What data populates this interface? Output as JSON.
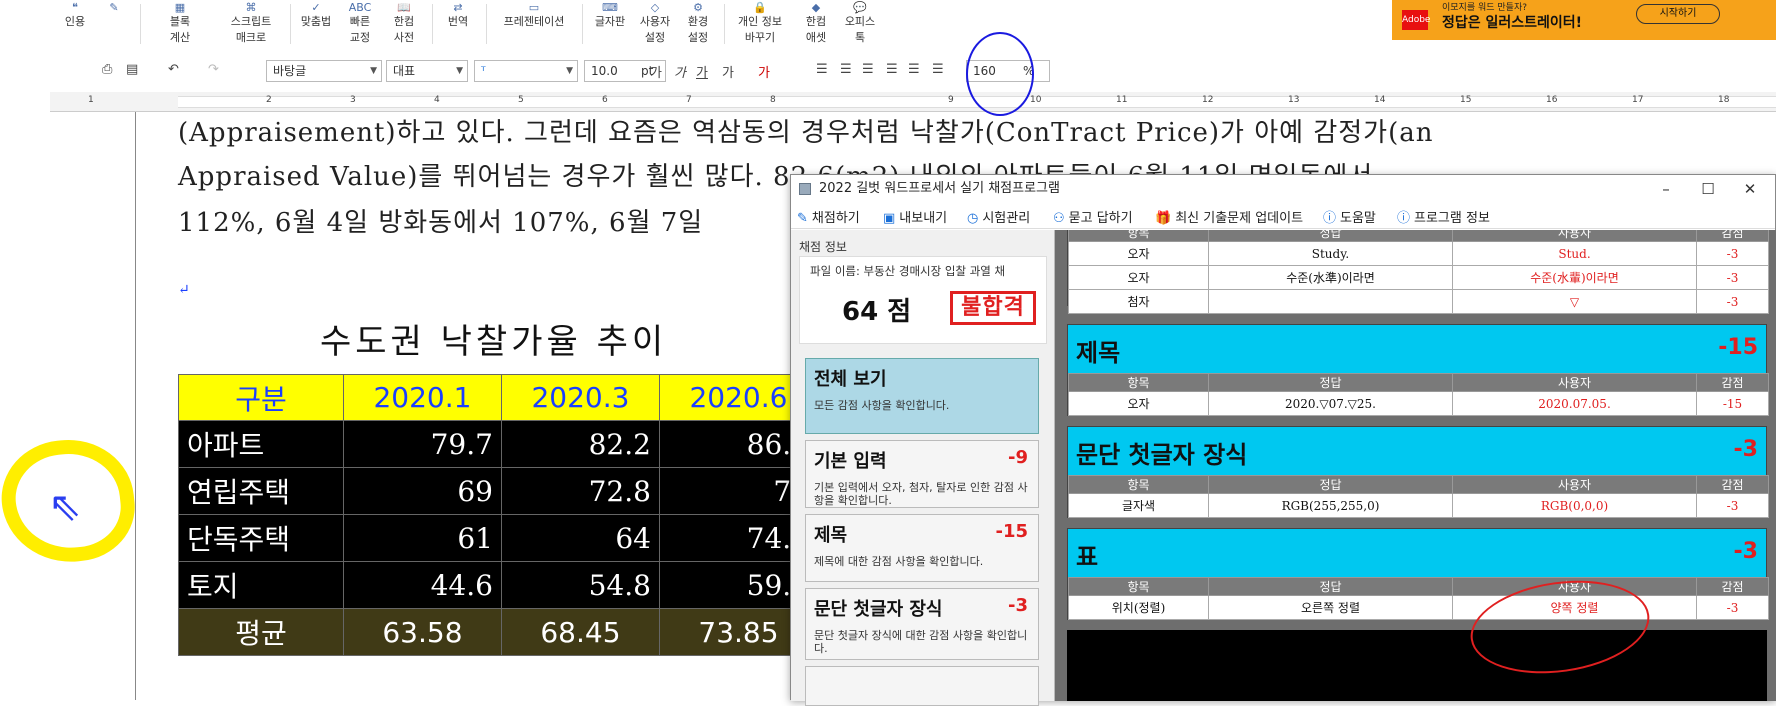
{
  "ribbon": {
    "items": [
      {
        "label": "인용",
        "icon": "quote-icon"
      },
      {
        "label": "블록\n계산",
        "icon": "block-calc-icon"
      },
      {
        "label": "스크립트\n매크로",
        "icon": "script-icon"
      },
      {
        "label": "맞춤법",
        "icon": "spellcheck-icon"
      },
      {
        "label": "빠른\n교정",
        "icon": "abc-icon"
      },
      {
        "label": "한컴\n사전",
        "icon": "dictionary-icon"
      },
      {
        "label": "번역",
        "icon": "translate-icon"
      },
      {
        "label": "프레젠테이션",
        "icon": "presentation-icon"
      },
      {
        "label": "글자판",
        "icon": "keyboard-icon"
      },
      {
        "label": "사용자\n설정",
        "icon": "user-settings-icon"
      },
      {
        "label": "환경\n설정",
        "icon": "settings-icon"
      },
      {
        "label": "개인 정보\n바꾸기",
        "icon": "privacy-icon"
      },
      {
        "label": "한컴\n애셋",
        "icon": "asset-icon"
      },
      {
        "label": "오피스\n톡",
        "icon": "office-talk-icon"
      }
    ],
    "ribbon_top_label": "ABC"
  },
  "ad": {
    "line1": "이모지를 워드 만들자?",
    "line2": "정답은 일러스트레이터!",
    "button": "시작하기",
    "logo": "Adobe"
  },
  "format_toolbar": {
    "style": "바탕글",
    "type": "대표",
    "font": "",
    "size": "10.0",
    "unit": "pt",
    "zoom": "160",
    "zoom_unit": "%"
  },
  "ruler": {
    "numbers": [
      "1",
      "2",
      "3",
      "4",
      "5",
      "6",
      "7",
      "8",
      "9",
      "10",
      "11",
      "12",
      "13",
      "14",
      "15",
      "16",
      "17",
      "18"
    ]
  },
  "document": {
    "lines": [
      "(Appraisement)하고 있다. 그런데 요즘은 역삼동의 경우처럼 낙찰가(ConTract Price)가 아예 감정가(an",
      "Appraised Value)를 뛰어넘는 경우가 훨씬 많다. 82.6(m2) 내외의 아파트들이 6월 11일 면일동에서",
      "112%, 6월 4일 방화동에서 107%, 6월 7일"
    ],
    "caption": "수도권 낙찰가율 추이",
    "table": {
      "headers": [
        "구분",
        "2020.1",
        "2020.3",
        "2020.6"
      ],
      "rows": [
        [
          "아파트",
          "79.7",
          "82.2",
          "86.9"
        ],
        [
          "연립주택",
          "69",
          "72.8",
          "75"
        ],
        [
          "단독주택",
          "61",
          "64",
          "74.3"
        ],
        [
          "토지",
          "44.6",
          "54.8",
          "59.2"
        ]
      ],
      "avg": [
        "평균",
        "63.58",
        "68.45",
        "73.85"
      ]
    }
  },
  "grader": {
    "title": "2022 길벗 워드프로세서 실기 채점프로그램",
    "menu": [
      {
        "label": "채점하기",
        "icon": "pencil-icon"
      },
      {
        "label": "내보내기",
        "icon": "save-icon"
      },
      {
        "label": "시험관리",
        "icon": "clock-icon"
      },
      {
        "label": "묻고 답하기",
        "icon": "qa-icon"
      },
      {
        "label": "최신 기출문제 업데이트",
        "icon": "gift-icon"
      },
      {
        "label": "도움말",
        "icon": "help-icon"
      },
      {
        "label": "프로그램 정보",
        "icon": "info-icon"
      }
    ],
    "info": {
      "label": "채점 정보",
      "filename": "파일 이름: 부동산 경매시장 입찰 과열 채",
      "score": "64 점",
      "result": "불합격"
    },
    "categories": [
      {
        "title": "전체 보기",
        "score": "",
        "desc": "모든 감점 사항을 확인합니다."
      },
      {
        "title": "기본 입력",
        "score": "-9",
        "desc": "기본 입력에서 오자, 첨자, 탈자로 인한 감점 사항을 확인합니다."
      },
      {
        "title": "제목",
        "score": "-15",
        "desc": "제목에 대한 감점 사항을 확인합니다."
      },
      {
        "title": "문단 첫글자 장식",
        "score": "-3",
        "desc": "문단 첫글자 장식에 대한 감점 사항을 확인합니다."
      }
    ],
    "columns": [
      "항목",
      "정답",
      "사용자",
      "감점"
    ],
    "top_rows": [
      [
        "오자",
        "Study.",
        "Stud.",
        "-3"
      ],
      [
        "오자",
        "수준(水準)이라면",
        "수준(水輩)이라면",
        "-3"
      ],
      [
        "첨자",
        "",
        "▽",
        "-3"
      ]
    ],
    "sections": [
      {
        "title": "제목",
        "score": "-15",
        "rows": [
          [
            "오자",
            "2020.▽07.▽25.",
            "2020.07.05.",
            "-15"
          ]
        ]
      },
      {
        "title": "문단 첫글자 장식",
        "score": "-3",
        "rows": [
          [
            "글자색",
            "RGB(255,255,0)",
            "RGB(0,0,0)",
            "-3"
          ]
        ]
      },
      {
        "title": "표",
        "score": "-3",
        "rows": [
          [
            "위치(정렬)",
            "오른쪽 정렬",
            "양쪽 정렬",
            "-3"
          ]
        ]
      }
    ]
  },
  "colors": {
    "accent_cyan": "#00c8f0",
    "penalty_red": "#e02020",
    "table_header_yellow": "#ffff00"
  }
}
